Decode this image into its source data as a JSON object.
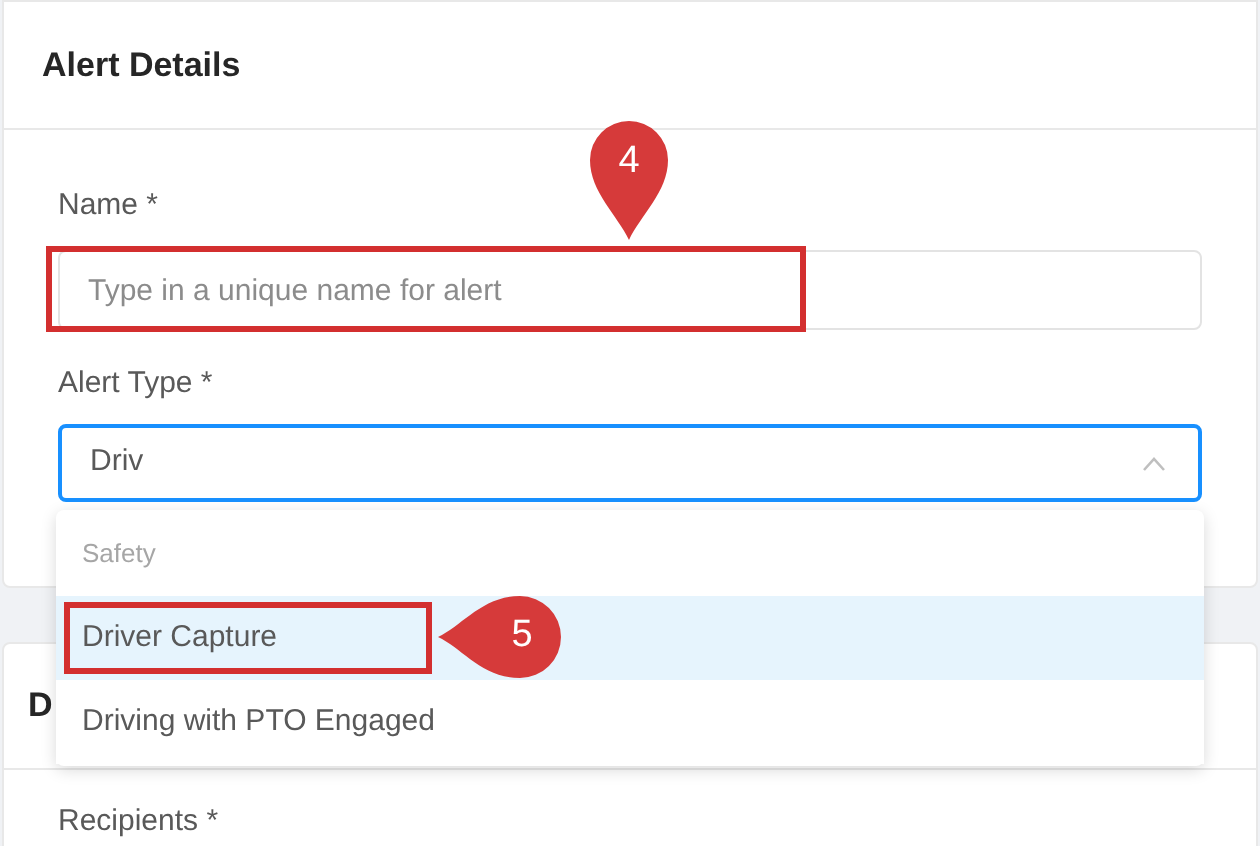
{
  "alert_details": {
    "title": "Alert Details",
    "name_field": {
      "label": "Name *",
      "placeholder": "Type in a unique name for alert",
      "highlighted": true,
      "callout": "4"
    },
    "alert_type": {
      "label": "Alert Type *",
      "value": "Driv",
      "focused": true,
      "expanded": true,
      "groups": [
        {
          "label": "Safety",
          "options": [
            {
              "label": "Driver Capture",
              "selected": true,
              "highlighted": true,
              "callout": "5"
            },
            {
              "label": "Driving with PTO Engaged",
              "selected": false,
              "highlighted": false
            }
          ]
        }
      ]
    }
  },
  "second_card": {
    "title": "D",
    "fields": [
      {
        "label": "Recipients *"
      }
    ]
  }
}
